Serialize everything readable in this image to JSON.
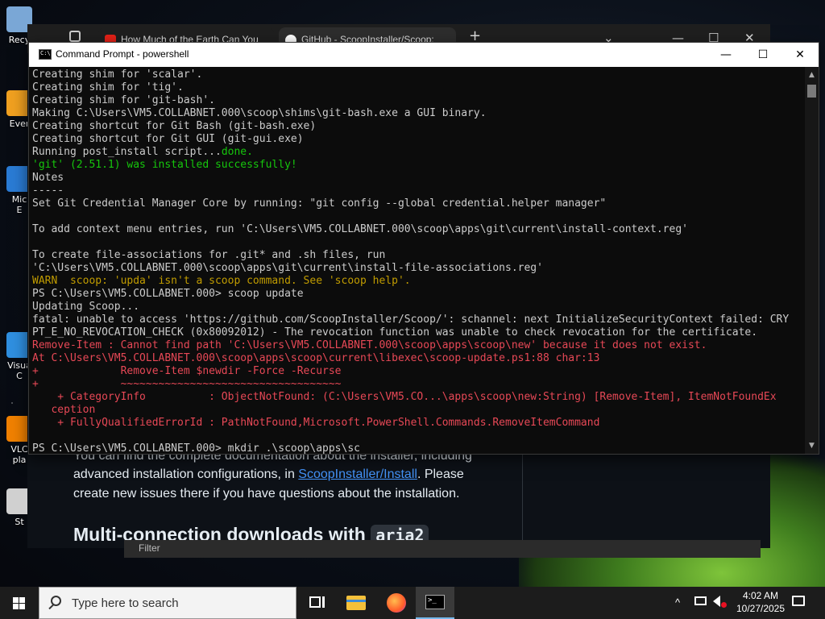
{
  "desktop": {
    "icons": [
      {
        "label": "Recy",
        "color": "#7aa7d6"
      },
      {
        "label": "Ever",
        "color": "#f0a020"
      },
      {
        "label": "Mic\nE",
        "color": "#2a7bd4"
      },
      {
        "label": "Visua\nC",
        "color": "#2f8fe0"
      },
      {
        "label": "VLC\npla",
        "color": "#f08000"
      },
      {
        "label": "St",
        "color": "#d0d0d0"
      }
    ]
  },
  "browser": {
    "tabs": [
      {
        "label": "How Much of the Earth Can You",
        "icon_color": "#e62117"
      },
      {
        "label": "GitHub - ScoopInstaller/Scoop:",
        "icon_color": "#ffffff"
      }
    ],
    "new_tab": "+",
    "ctrl_dropdown": "⌄",
    "ctrl_min": "—",
    "ctrl_max": "☐",
    "ctrl_close": "✕",
    "content_line1": "You can find the complete documentation about the installer, including",
    "content_line2_pre": "advanced installation configurations, in ",
    "content_link": "ScoopInstaller/Install",
    "content_line2_post": ". Please",
    "content_line3": "create new issues there if you have questions about the installation.",
    "heading_text": "Multi-connection downloads with ",
    "heading_code": "aria2",
    "footer_text": "Filter"
  },
  "console": {
    "title": "Command Prompt - powershell",
    "btn_min": "—",
    "btn_max": "☐",
    "btn_close": "✕",
    "lines": [
      {
        "t": "Creating shim for 'scalar'.",
        "c": ""
      },
      {
        "t": "Creating shim for 'tig'.",
        "c": ""
      },
      {
        "t": "Creating shim for 'git-bash'.",
        "c": ""
      },
      {
        "t": "Making C:\\Users\\VM5.COLLABNET.000\\scoop\\shims\\git-bash.exe a GUI binary.",
        "c": ""
      },
      {
        "t": "Creating shortcut for Git Bash (git-bash.exe)",
        "c": ""
      },
      {
        "t": "Creating shortcut for Git GUI (git-gui.exe)",
        "c": ""
      },
      {
        "t": "Running post_install script...",
        "c": "",
        "tail": "done.",
        "tailc": "c-green"
      },
      {
        "t": "'git' (2.51.1) was installed successfully!",
        "c": "c-green"
      },
      {
        "t": "Notes",
        "c": ""
      },
      {
        "t": "-----",
        "c": ""
      },
      {
        "t": "Set Git Credential Manager Core by running: \"git config --global credential.helper manager\"",
        "c": ""
      },
      {
        "t": "",
        "c": ""
      },
      {
        "t": "To add context menu entries, run 'C:\\Users\\VM5.COLLABNET.000\\scoop\\apps\\git\\current\\install-context.reg'",
        "c": ""
      },
      {
        "t": "",
        "c": ""
      },
      {
        "t": "To create file-associations for .git* and .sh files, run",
        "c": ""
      },
      {
        "t": "'C:\\Users\\VM5.COLLABNET.000\\scoop\\apps\\git\\current\\install-file-associations.reg'",
        "c": ""
      },
      {
        "t": "WARN  scoop: 'upda' isn't a scoop command. See 'scoop help'.",
        "c": "c-yellow"
      },
      {
        "t": "PS C:\\Users\\VM5.COLLABNET.000> scoop update",
        "c": ""
      },
      {
        "t": "Updating Scoop...",
        "c": ""
      },
      {
        "t": "fatal: unable to access 'https://github.com/ScoopInstaller/Scoop/': schannel: next InitializeSecurityContext failed: CRY",
        "c": ""
      },
      {
        "t": "PT_E_NO_REVOCATION_CHECK (0x80092012) - The revocation function was unable to check revocation for the certificate.",
        "c": ""
      },
      {
        "t": "Remove-Item : Cannot find path 'C:\\Users\\VM5.COLLABNET.000\\scoop\\apps\\scoop\\new' because it does not exist.",
        "c": "c-red"
      },
      {
        "t": "At C:\\Users\\VM5.COLLABNET.000\\scoop\\apps\\scoop\\current\\libexec\\scoop-update.ps1:88 char:13",
        "c": "c-red"
      },
      {
        "t": "+             Remove-Item $newdir -Force -Recurse",
        "c": "c-red"
      },
      {
        "t": "+             ~~~~~~~~~~~~~~~~~~~~~~~~~~~~~~~~~~~",
        "c": "c-red"
      },
      {
        "t": "    + CategoryInfo          : ObjectNotFound: (C:\\Users\\VM5.CO...\\apps\\scoop\\new:String) [Remove-Item], ItemNotFoundEx",
        "c": "c-red"
      },
      {
        "t": "   ception",
        "c": "c-red"
      },
      {
        "t": "    + FullyQualifiedErrorId : PathNotFound,Microsoft.PowerShell.Commands.RemoveItemCommand",
        "c": "c-red"
      },
      {
        "t": "",
        "c": ""
      },
      {
        "t": "PS C:\\Users\\VM5.COLLABNET.000> mkdir .\\scoop\\apps\\sc",
        "c": ""
      }
    ]
  },
  "taskbar": {
    "search_placeholder": "Type here to search",
    "time": "4:02 AM",
    "date": "10/27/2025",
    "icons": [
      "task-view-icon",
      "file-explorer-icon",
      "firefox-icon",
      "terminal-icon"
    ]
  }
}
